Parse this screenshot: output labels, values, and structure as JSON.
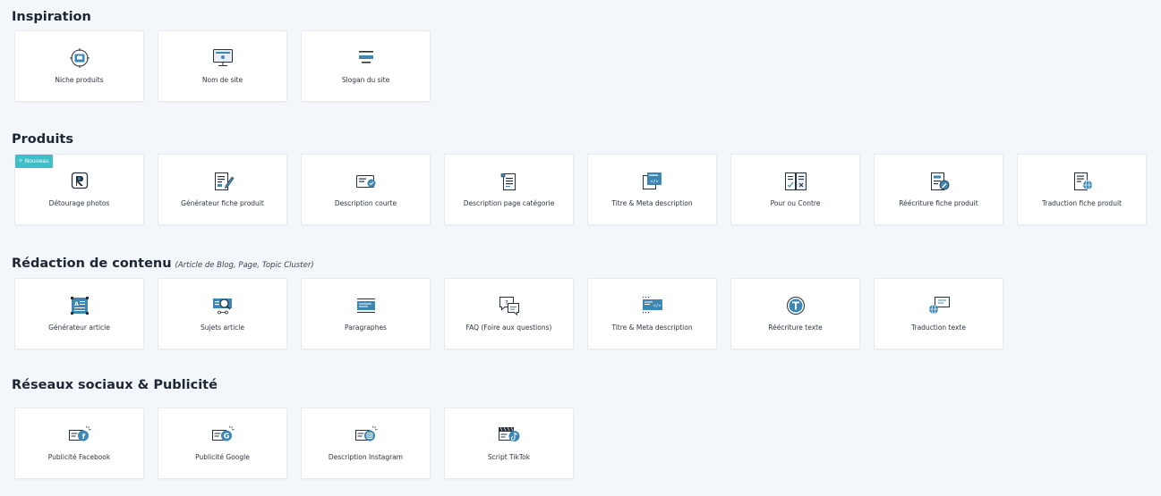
{
  "colors": {
    "background": "#f3f6fa",
    "card": "#ffffff",
    "icon_primary": "#3d87b2",
    "icon_dark": "#25303b",
    "icon_light": "#e8eef4",
    "badge": "#3fc0c7"
  },
  "sections": {
    "inspiration": {
      "title": "Inspiration",
      "cards": [
        {
          "label": "Niche produits",
          "icon": "target-product-icon"
        },
        {
          "label": "Nom de site",
          "icon": "monitor-icon"
        },
        {
          "label": "Slogan du site",
          "icon": "text-lines-icon"
        }
      ]
    },
    "produits": {
      "title": "Produits",
      "badge": "Nouveau",
      "cards": [
        {
          "label": "Détourage photos",
          "icon": "photo-cutout-icon"
        },
        {
          "label": "Générateur fiche produit",
          "icon": "document-pencil-icon"
        },
        {
          "label": "Description courte",
          "icon": "card-check-icon"
        },
        {
          "label": "Description page catégorie",
          "icon": "category-page-icon"
        },
        {
          "label": "Titre & Meta description",
          "icon": "code-document-icon"
        },
        {
          "label": "Pour ou Contre",
          "icon": "pros-cons-icon"
        },
        {
          "label": "Réécriture fiche produit",
          "icon": "document-rewrite-icon"
        },
        {
          "label": "Traduction fiche produit",
          "icon": "document-globe-icon"
        }
      ]
    },
    "redaction": {
      "title": "Rédaction de contenu",
      "subtitle": "(Article de Blog, Page, Topic Cluster)",
      "cards": [
        {
          "label": "Générateur article",
          "icon": "article-generator-icon"
        },
        {
          "label": "Sujets article",
          "icon": "topic-search-icon"
        },
        {
          "label": "Paragraphes",
          "icon": "paragraph-icon"
        },
        {
          "label": "FAQ (Foire aux questions)",
          "icon": "faq-chat-icon"
        },
        {
          "label": "Titre & Meta description",
          "icon": "meta-code-icon"
        },
        {
          "label": "Réécriture texte",
          "icon": "text-rewrite-icon"
        },
        {
          "label": "Traduction texte",
          "icon": "text-translate-icon"
        }
      ]
    },
    "reseaux": {
      "title": "Réseaux sociaux & Publicité",
      "cards": [
        {
          "label": "Publicité Facebook",
          "icon": "facebook-ad-icon"
        },
        {
          "label": "Publicité Google",
          "icon": "google-ad-icon"
        },
        {
          "label": "Description Instagram",
          "icon": "instagram-icon"
        },
        {
          "label": "Script TikTok",
          "icon": "tiktok-icon"
        }
      ]
    }
  }
}
